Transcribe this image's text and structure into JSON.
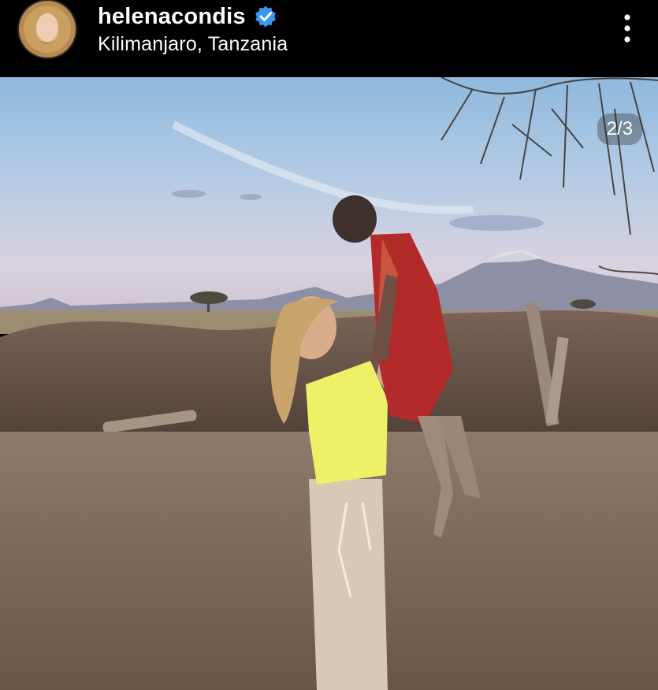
{
  "post_header": {
    "username": "helenacondis",
    "verified": true,
    "location": "Kilimanjaro, Tanzania",
    "avatar_icon": "profile-photo",
    "more_icon": "more-vertical-icon"
  },
  "media": {
    "counter": "2/3",
    "description_icon": "photo"
  },
  "colors": {
    "header_bg": "#000000",
    "verified_blue": "#3897f0",
    "text": "#ffffff"
  }
}
